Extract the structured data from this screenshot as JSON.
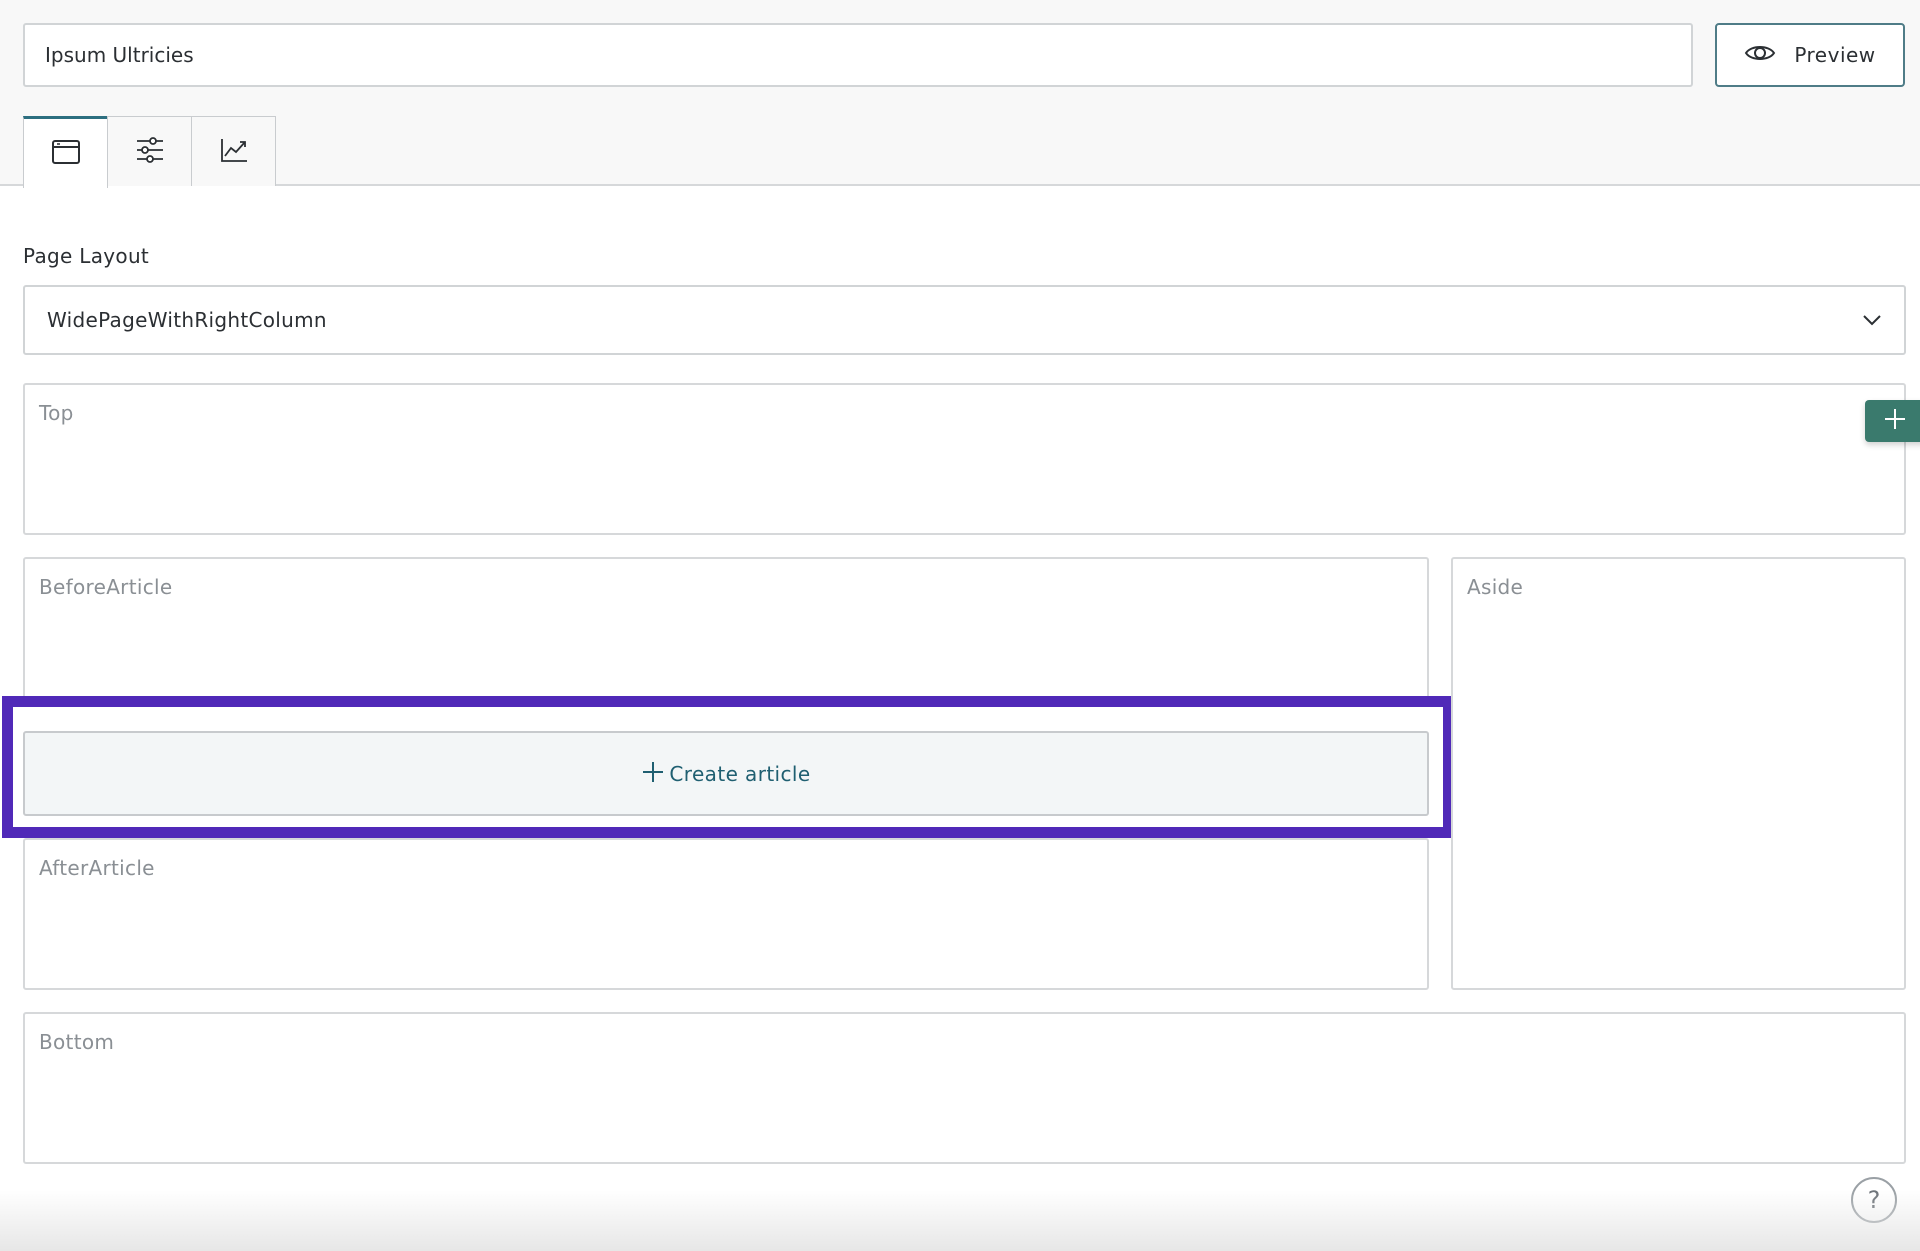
{
  "header": {
    "title_value": "Ipsum Ultricies",
    "preview_label": "Preview"
  },
  "tabs": [
    {
      "icon": "browser-window-icon",
      "active": true
    },
    {
      "icon": "sliders-icon",
      "active": false
    },
    {
      "icon": "chart-line-icon",
      "active": false
    }
  ],
  "layout": {
    "label": "Page Layout",
    "selected": "WidePageWithRightColumn"
  },
  "zones": {
    "top": "Top",
    "before_article": "BeforeArticle",
    "after_article": "AfterArticle",
    "aside": "Aside",
    "bottom": "Bottom"
  },
  "create_article": {
    "label": "Create article"
  },
  "help": {
    "label": "?"
  },
  "colors": {
    "accent": "#2d6f80",
    "add_button": "#3a7a6d",
    "highlight": "#5029b8"
  }
}
